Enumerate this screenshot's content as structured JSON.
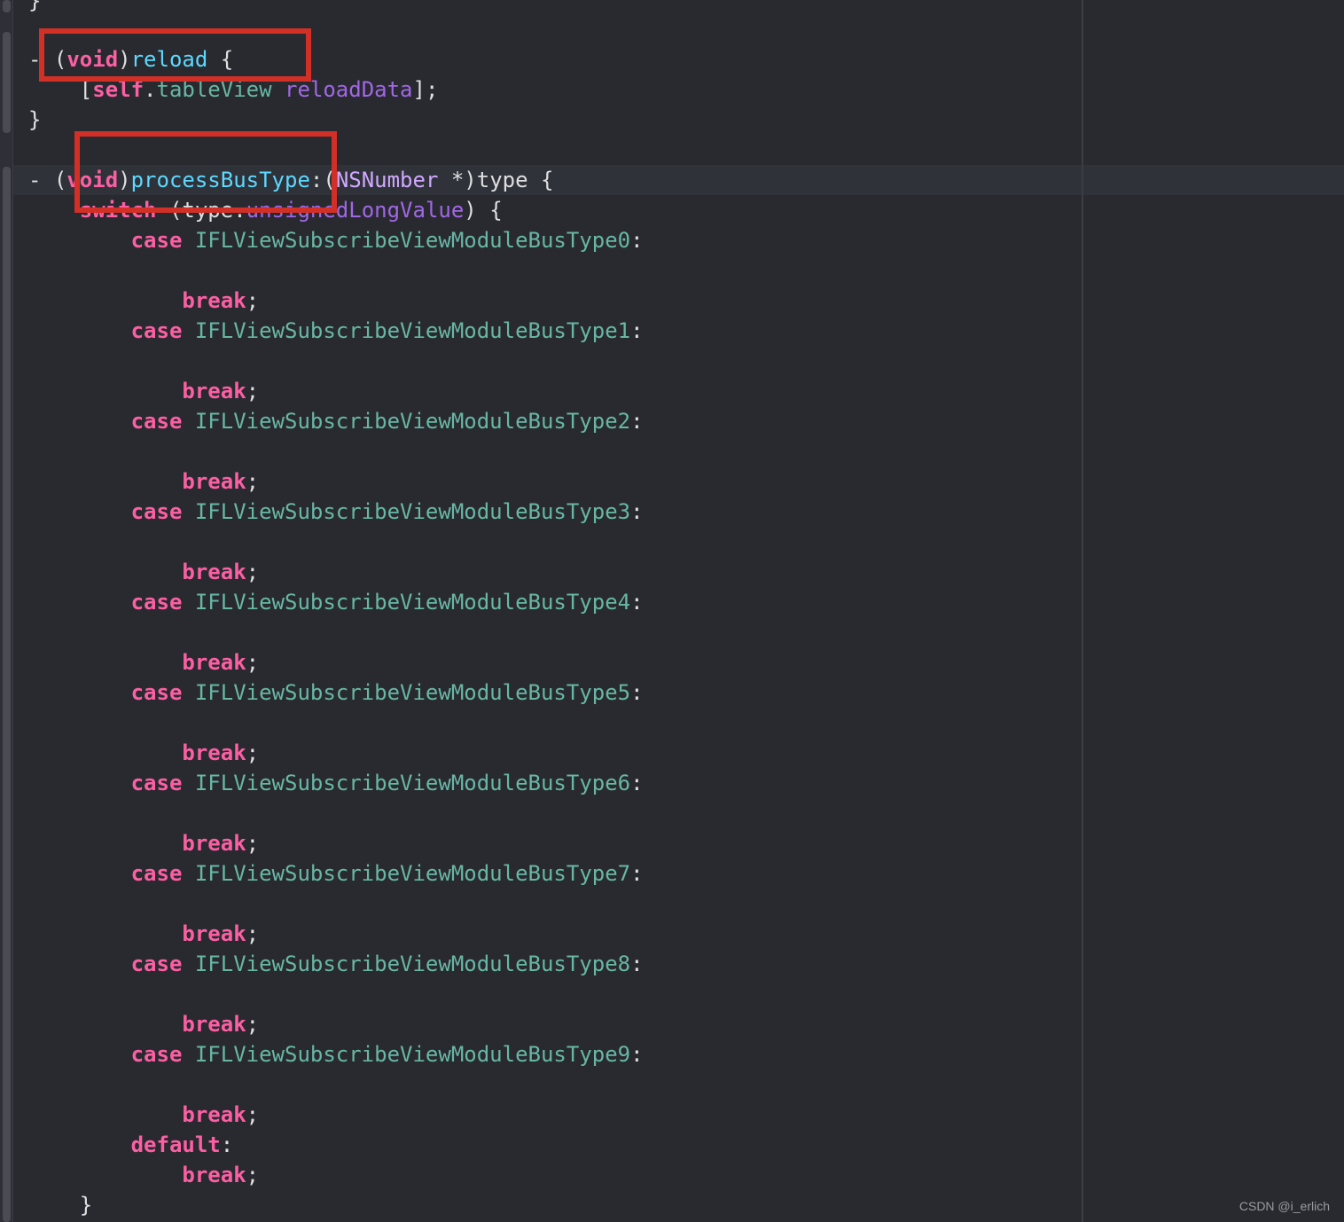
{
  "editor": {
    "lines": [
      {
        "id": "l0",
        "segments": [
          {
            "t": "}",
            "c": "plain"
          }
        ]
      },
      {
        "id": "l1",
        "segments": [
          {
            "t": "- (",
            "c": "plain"
          },
          {
            "t": "void",
            "c": "kw"
          },
          {
            "t": ")",
            "c": "plain"
          },
          {
            "t": "reload",
            "c": "fn-blue"
          },
          {
            "t": " {",
            "c": "plain"
          }
        ]
      },
      {
        "id": "l2",
        "segments": [
          {
            "t": "    [",
            "c": "plain"
          },
          {
            "t": "self",
            "c": "kw"
          },
          {
            "t": ".",
            "c": "plain"
          },
          {
            "t": "tableView",
            "c": "fn"
          },
          {
            "t": " ",
            "c": "plain"
          },
          {
            "t": "reloadData",
            "c": "method"
          },
          {
            "t": "];",
            "c": "plain"
          }
        ]
      },
      {
        "id": "l3",
        "segments": [
          {
            "t": "}",
            "c": "plain"
          }
        ]
      },
      {
        "id": "l4",
        "segments": [
          {
            "t": "",
            "c": "plain"
          }
        ]
      },
      {
        "id": "l5",
        "segments": [
          {
            "t": "- (",
            "c": "plain"
          },
          {
            "t": "void",
            "c": "kw"
          },
          {
            "t": ")",
            "c": "plain"
          },
          {
            "t": "processBusType",
            "c": "fn-blue"
          },
          {
            "t": ":(",
            "c": "plain"
          },
          {
            "t": "NSNumber",
            "c": "cls"
          },
          {
            "t": " *)type {",
            "c": "plain"
          }
        ]
      },
      {
        "id": "l6",
        "segments": [
          {
            "t": "    ",
            "c": "plain"
          },
          {
            "t": "switch",
            "c": "kw"
          },
          {
            "t": " (type.",
            "c": "plain"
          },
          {
            "t": "unsignedLongValue",
            "c": "method"
          },
          {
            "t": ") {",
            "c": "plain"
          }
        ]
      },
      {
        "id": "l7",
        "segments": [
          {
            "t": "        ",
            "c": "plain"
          },
          {
            "t": "case",
            "c": "kw"
          },
          {
            "t": " ",
            "c": "plain"
          },
          {
            "t": "IFLViewSubscribeViewModuleBusType0",
            "c": "const"
          },
          {
            "t": ":",
            "c": "plain"
          }
        ]
      },
      {
        "id": "l8",
        "segments": [
          {
            "t": "",
            "c": "plain"
          }
        ]
      },
      {
        "id": "l9",
        "segments": [
          {
            "t": "            ",
            "c": "plain"
          },
          {
            "t": "break",
            "c": "kw"
          },
          {
            "t": ";",
            "c": "plain"
          }
        ]
      },
      {
        "id": "l10",
        "segments": [
          {
            "t": "        ",
            "c": "plain"
          },
          {
            "t": "case",
            "c": "kw"
          },
          {
            "t": " ",
            "c": "plain"
          },
          {
            "t": "IFLViewSubscribeViewModuleBusType1",
            "c": "const"
          },
          {
            "t": ":",
            "c": "plain"
          }
        ]
      },
      {
        "id": "l11",
        "segments": [
          {
            "t": "",
            "c": "plain"
          }
        ]
      },
      {
        "id": "l12",
        "segments": [
          {
            "t": "            ",
            "c": "plain"
          },
          {
            "t": "break",
            "c": "kw"
          },
          {
            "t": ";",
            "c": "plain"
          }
        ]
      },
      {
        "id": "l13",
        "segments": [
          {
            "t": "        ",
            "c": "plain"
          },
          {
            "t": "case",
            "c": "kw"
          },
          {
            "t": " ",
            "c": "plain"
          },
          {
            "t": "IFLViewSubscribeViewModuleBusType2",
            "c": "const"
          },
          {
            "t": ":",
            "c": "plain"
          }
        ]
      },
      {
        "id": "l14",
        "segments": [
          {
            "t": "",
            "c": "plain"
          }
        ]
      },
      {
        "id": "l15",
        "segments": [
          {
            "t": "            ",
            "c": "plain"
          },
          {
            "t": "break",
            "c": "kw"
          },
          {
            "t": ";",
            "c": "plain"
          }
        ]
      },
      {
        "id": "l16",
        "segments": [
          {
            "t": "        ",
            "c": "plain"
          },
          {
            "t": "case",
            "c": "kw"
          },
          {
            "t": " ",
            "c": "plain"
          },
          {
            "t": "IFLViewSubscribeViewModuleBusType3",
            "c": "const"
          },
          {
            "t": ":",
            "c": "plain"
          }
        ]
      },
      {
        "id": "l17",
        "segments": [
          {
            "t": "",
            "c": "plain"
          }
        ]
      },
      {
        "id": "l18",
        "segments": [
          {
            "t": "            ",
            "c": "plain"
          },
          {
            "t": "break",
            "c": "kw"
          },
          {
            "t": ";",
            "c": "plain"
          }
        ]
      },
      {
        "id": "l19",
        "segments": [
          {
            "t": "        ",
            "c": "plain"
          },
          {
            "t": "case",
            "c": "kw"
          },
          {
            "t": " ",
            "c": "plain"
          },
          {
            "t": "IFLViewSubscribeViewModuleBusType4",
            "c": "const"
          },
          {
            "t": ":",
            "c": "plain"
          }
        ]
      },
      {
        "id": "l20",
        "segments": [
          {
            "t": "",
            "c": "plain"
          }
        ]
      },
      {
        "id": "l21",
        "segments": [
          {
            "t": "            ",
            "c": "plain"
          },
          {
            "t": "break",
            "c": "kw"
          },
          {
            "t": ";",
            "c": "plain"
          }
        ]
      },
      {
        "id": "l22",
        "segments": [
          {
            "t": "        ",
            "c": "plain"
          },
          {
            "t": "case",
            "c": "kw"
          },
          {
            "t": " ",
            "c": "plain"
          },
          {
            "t": "IFLViewSubscribeViewModuleBusType5",
            "c": "const"
          },
          {
            "t": ":",
            "c": "plain"
          }
        ]
      },
      {
        "id": "l23",
        "segments": [
          {
            "t": "",
            "c": "plain"
          }
        ]
      },
      {
        "id": "l24",
        "segments": [
          {
            "t": "            ",
            "c": "plain"
          },
          {
            "t": "break",
            "c": "kw"
          },
          {
            "t": ";",
            "c": "plain"
          }
        ]
      },
      {
        "id": "l25",
        "segments": [
          {
            "t": "        ",
            "c": "plain"
          },
          {
            "t": "case",
            "c": "kw"
          },
          {
            "t": " ",
            "c": "plain"
          },
          {
            "t": "IFLViewSubscribeViewModuleBusType6",
            "c": "const"
          },
          {
            "t": ":",
            "c": "plain"
          }
        ]
      },
      {
        "id": "l26",
        "segments": [
          {
            "t": "",
            "c": "plain"
          }
        ]
      },
      {
        "id": "l27",
        "segments": [
          {
            "t": "            ",
            "c": "plain"
          },
          {
            "t": "break",
            "c": "kw"
          },
          {
            "t": ";",
            "c": "plain"
          }
        ]
      },
      {
        "id": "l28",
        "segments": [
          {
            "t": "        ",
            "c": "plain"
          },
          {
            "t": "case",
            "c": "kw"
          },
          {
            "t": " ",
            "c": "plain"
          },
          {
            "t": "IFLViewSubscribeViewModuleBusType7",
            "c": "const"
          },
          {
            "t": ":",
            "c": "plain"
          }
        ]
      },
      {
        "id": "l29",
        "segments": [
          {
            "t": "",
            "c": "plain"
          }
        ]
      },
      {
        "id": "l30",
        "segments": [
          {
            "t": "            ",
            "c": "plain"
          },
          {
            "t": "break",
            "c": "kw"
          },
          {
            "t": ";",
            "c": "plain"
          }
        ]
      },
      {
        "id": "l31",
        "segments": [
          {
            "t": "        ",
            "c": "plain"
          },
          {
            "t": "case",
            "c": "kw"
          },
          {
            "t": " ",
            "c": "plain"
          },
          {
            "t": "IFLViewSubscribeViewModuleBusType8",
            "c": "const"
          },
          {
            "t": ":",
            "c": "plain"
          }
        ]
      },
      {
        "id": "l32",
        "segments": [
          {
            "t": "",
            "c": "plain"
          }
        ]
      },
      {
        "id": "l33",
        "segments": [
          {
            "t": "            ",
            "c": "plain"
          },
          {
            "t": "break",
            "c": "kw"
          },
          {
            "t": ";",
            "c": "plain"
          }
        ]
      },
      {
        "id": "l34",
        "segments": [
          {
            "t": "        ",
            "c": "plain"
          },
          {
            "t": "case",
            "c": "kw"
          },
          {
            "t": " ",
            "c": "plain"
          },
          {
            "t": "IFLViewSubscribeViewModuleBusType9",
            "c": "const"
          },
          {
            "t": ":",
            "c": "plain"
          }
        ]
      },
      {
        "id": "l35",
        "segments": [
          {
            "t": "",
            "c": "plain"
          }
        ]
      },
      {
        "id": "l36",
        "segments": [
          {
            "t": "            ",
            "c": "plain"
          },
          {
            "t": "break",
            "c": "kw"
          },
          {
            "t": ";",
            "c": "plain"
          }
        ]
      },
      {
        "id": "l37",
        "segments": [
          {
            "t": "        ",
            "c": "plain"
          },
          {
            "t": "default",
            "c": "kw"
          },
          {
            "t": ":",
            "c": "plain"
          }
        ]
      },
      {
        "id": "l38",
        "segments": [
          {
            "t": "            ",
            "c": "plain"
          },
          {
            "t": "break",
            "c": "kw"
          },
          {
            "t": ";",
            "c": "plain"
          }
        ]
      },
      {
        "id": "l39",
        "segments": [
          {
            "t": "    }",
            "c": "plain"
          }
        ]
      }
    ]
  },
  "watermark": "CSDN @i_erlich",
  "colors": {
    "background": "#292a30",
    "keyword": "#fc5fa3",
    "function": "#5dd8ff",
    "property": "#67b7a4",
    "method": "#a167e6",
    "class": "#d0a8ff",
    "annotation_box": "#d22f27"
  }
}
